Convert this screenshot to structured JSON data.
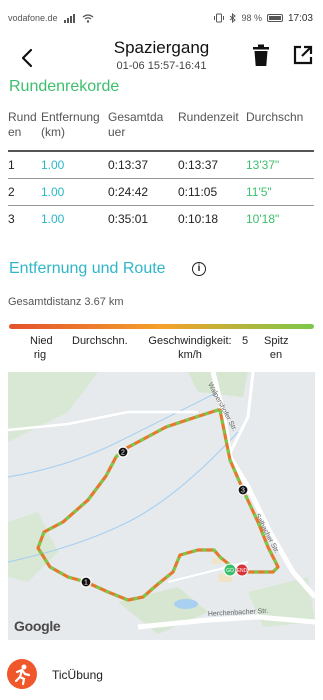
{
  "status_bar": {
    "carrier": "vodafone.de",
    "battery": "98 %",
    "time": "17:03"
  },
  "header": {
    "title": "Spaziergang",
    "subtitle": "01-06 15:57-16:41"
  },
  "laps_section": {
    "title": "Rundenrekorde",
    "headers": [
      "Rund\nen",
      "Entfernung\n(km)",
      "Gesamtda\nuer",
      "Rundenzeit",
      "Durchschn"
    ],
    "rows": [
      [
        "1",
        "1.00",
        "0:13:37",
        "0:13:37",
        "13'37\""
      ],
      [
        "2",
        "1.00",
        "0:24:42",
        "0:11:05",
        "11'5\""
      ],
      [
        "3",
        "1.00",
        "0:35:01",
        "0:10:18",
        "10'18\""
      ]
    ]
  },
  "route_section": {
    "title": "Entfernung und Route",
    "total_distance": "Gesamtdistanz 3.67 km",
    "legend": {
      "low": "Nied\nrig",
      "avg": "Durchschn.",
      "speed": "Geschwindigkeit:\nkm/h",
      "value": "5",
      "high": "Spitz\nen"
    }
  },
  "map": {
    "streets": [
      "Walpershofer Str.",
      "Salbacher Str.",
      "Herchenbacher Str."
    ],
    "markers": [
      "1",
      "2",
      "3"
    ],
    "start_label": "GO",
    "end_label": "END",
    "attribution": "Google"
  },
  "footer": {
    "app_name": "TicÜbung"
  },
  "colors": {
    "green": "#3cbf6d",
    "teal": "#2fb7c9",
    "orange": "#f0572a"
  }
}
